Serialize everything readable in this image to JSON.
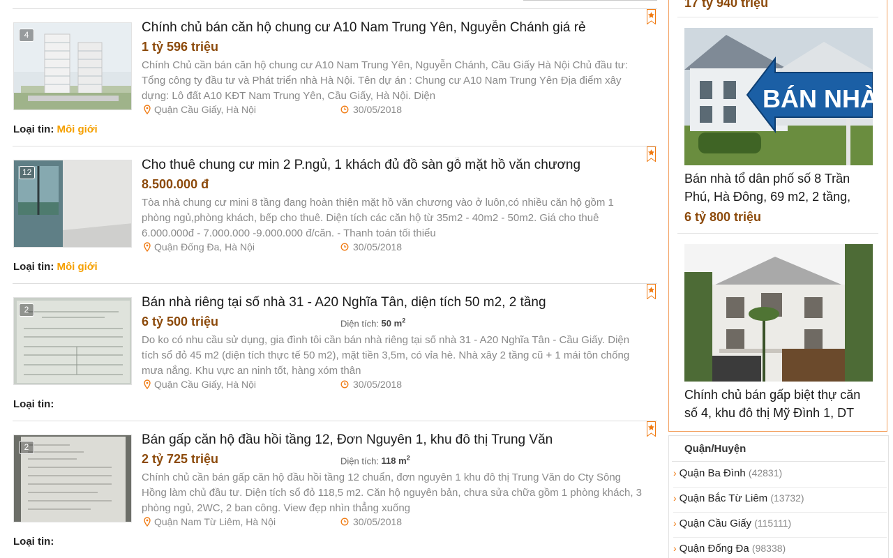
{
  "listings": [
    {
      "title": "Chính chủ bán căn hộ chung cư A10 Nam Trung Yên, Nguyễn Chánh giá rẻ",
      "price": "1 tỷ 596 triệu",
      "area_label": "",
      "area_value": "",
      "description": "Chính Chủ cần bán căn hộ chung cư A10 Nam Trung Yên, Nguyễn Chánh, Cầu Giấy Hà Nội Chủ đầu tư: Tổng công ty đầu tư và Phát triển nhà Hà Nội. Tên dự án : Chung cư A10 Nam Trung Yên Địa điểm xây dựng: Lô đất A10 KĐT Nam Trung Yên, Cầu Giấy, Hà Nội. Diện",
      "location": "Quận Cầu Giấy, Hà Nội",
      "date": "30/05/2018",
      "photo_count": "4",
      "type_label": "Loại tin",
      "type_value": "Môi giới"
    },
    {
      "title": "Cho thuê chung cư min 2 P.ngủ, 1 khách đủ đồ sàn gỗ mặt hồ văn chương",
      "price": "8.500.000 đ",
      "area_label": "",
      "area_value": "",
      "description": "Tòa nhà chung cư mini 8 tầng đang hoàn thiện mặt hồ văn chương vào ở luôn,có nhiều căn hộ gồm 1 phòng ngủ,phòng khách, bếp cho thuê. Diện tích các căn hộ từ 35m2 - 40m2 - 50m2. Giá cho thuê 6.000.000đ - 7.000.000 -9.000.000 đ/căn. - Thanh toán tối thiểu",
      "location": "Quận Đống Đa, Hà Nội",
      "date": "30/05/2018",
      "photo_count": "12",
      "type_label": "Loại tin",
      "type_value": "Môi giới"
    },
    {
      "title": "Bán nhà riêng tại số nhà 31 - A20 Nghĩa Tân, diện tích 50 m2, 2 tầng",
      "price": "6 tỷ 500 triệu",
      "area_label": "Diện tích:",
      "area_value": "50 m",
      "description": "Do ko có nhu cầu sử dụng, gia đình tôi cần bán nhà riêng tại số nhà 31 - A20 Nghĩa Tân - Cầu Giấy. Diện tích sổ đỏ 45 m2 (diện tích thực tế 50 m2), mặt tiền 3,5m, có vỉa hè. Nhà xây 2 tầng cũ + 1 mái tôn chống mưa nắng. Khu vực an ninh tốt, hàng xóm thân",
      "location": "Quận Cầu Giấy, Hà Nội",
      "date": "30/05/2018",
      "photo_count": "2",
      "type_label": "Loại tin",
      "type_value": ""
    },
    {
      "title": "Bán gấp căn hộ đầu hồi tầng 12, Đơn Nguyên 1, khu đô thị Trung Văn",
      "price": "2 tỷ 725 triệu",
      "area_label": "Diện tích:",
      "area_value": "118 m",
      "description": "Chính chủ cần bán gấp căn hộ đầu hồi tầng 12 chuẩn, đơn nguyên 1 khu đô thị Trung Văn do Cty Sông Hồng làm chủ đầu tư. Diện tích sổ đỏ 118,5 m2. Căn hộ nguyên bản, chưa sửa chữa gồm 1 phòng khách, 3 phòng ngủ, 2WC, 2 ban công. View đẹp nhìn thẳng xuống",
      "location": "Quận Nam Từ Liêm, Hà Nội",
      "date": "30/05/2018",
      "photo_count": "2",
      "type_label": "Loại tin",
      "type_value": ""
    }
  ],
  "area_unit_sup": "2",
  "sidebar": {
    "previous_price": "17 tỷ 940 triệu",
    "cards": [
      {
        "sign_text": "BÁN NHÀ",
        "title": "Bán nhà tổ dân phố số 8 Trần Phú, Hà Đông, 69 m2, 2 tầng,",
        "price": "6 tỷ 800 triệu"
      },
      {
        "title": "Chính chủ bán gấp biệt thự căn số 4, khu đô thị Mỹ Đình 1, DT",
        "price": ""
      }
    ],
    "district_header": "Quận/Huyện",
    "districts": [
      {
        "name": "Quận Ba Đình",
        "count": "(42831)"
      },
      {
        "name": "Quận Bắc Từ Liêm",
        "count": "(13732)"
      },
      {
        "name": "Quận Cầu Giấy",
        "count": "(115111)"
      },
      {
        "name": "Quận Đống Đa",
        "count": "(98338)"
      }
    ]
  },
  "colors": {
    "price": "#8c4a0b",
    "type_value": "#f5a000",
    "sidebar_border": "#f3a160",
    "accent_orange": "#f07a11"
  }
}
